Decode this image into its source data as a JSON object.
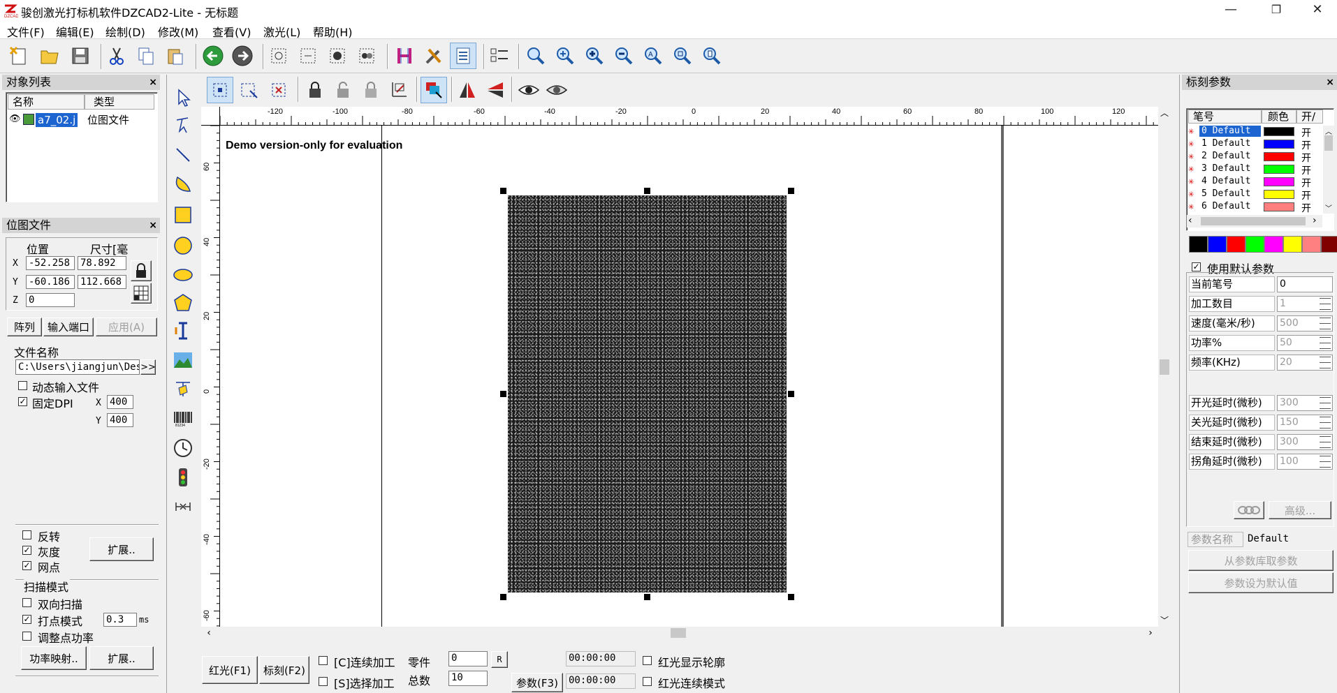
{
  "window": {
    "title": "骏创激光打标机软件DZCAD2-Lite - 无标题",
    "min_glyph": "—",
    "max_glyph": "❐",
    "close_glyph": "✕"
  },
  "menu": [
    "文件(F)",
    "编辑(E)",
    "绘制(D)",
    "修改(M)",
    "查看(V)",
    "激光(L)",
    "帮助(H)"
  ],
  "object_list": {
    "title": "对象列表",
    "columns": [
      "名称",
      "类型"
    ],
    "rows": [
      {
        "name": "a7_02.j",
        "type": "位图文件"
      }
    ]
  },
  "bitmap_panel": {
    "title": "位图文件",
    "pos_header": "位置",
    "size_header": "尺寸[毫",
    "x_label": "X",
    "y_label": "Y",
    "z_label": "Z",
    "x_pos": "-52.258",
    "x_size": "78.892",
    "y_pos": "-60.186",
    "y_size": "112.668",
    "z_pos": "0",
    "array_btn": "阵列",
    "port_btn": "输入端口",
    "apply_btn": "应用(A)",
    "file_name_label": "文件名称",
    "file_path": "C:\\Users\\jiangjun\\Des",
    "browse_btn": ">>",
    "dynamic_input": "动态输入文件",
    "fixed_dpi": "固定DPI",
    "dpi_x_label": "X",
    "dpi_x": "400",
    "dpi_y_label": "Y",
    "dpi_y": "400",
    "invert": "反转",
    "gray": "灰度",
    "dither": "网点",
    "expand_btn": "扩展..",
    "scan_mode": "扫描模式",
    "bidirectional": "双向扫描",
    "dot_mode": "打点模式",
    "dot_time": "0.3",
    "dot_unit": "ms",
    "adjust_power": "调整点功率",
    "power_map_btn": "功率映射..",
    "expand_btn2": "扩展.."
  },
  "canvas": {
    "watermark": "Demo version-only for evaluation",
    "ruler_top": [
      "-120",
      "-100",
      "-80",
      "-60",
      "-40",
      "-20",
      "0",
      "20",
      "40",
      "60",
      "80",
      "100",
      "120"
    ],
    "ruler_left": [
      "60",
      "40",
      "20",
      "0",
      "-20",
      "-40",
      "-60"
    ]
  },
  "bottom": {
    "red_btn": "红光(F1)",
    "mark_btn": "标刻(F2)",
    "continuous": "[C]连续加工",
    "select": "[S]选择加工",
    "parts_label": "零件",
    "parts_value": "0",
    "r_btn": "R",
    "total_label": "总数",
    "total_value": "10",
    "param_btn": "参数(F3)",
    "time1": "00:00:00",
    "time2": "00:00:00",
    "red_outline": "红光显示轮廓",
    "red_continuous": "红光连续模式"
  },
  "mark_params": {
    "title": "标刻参数",
    "columns": [
      "笔号",
      "颜色",
      "开/"
    ],
    "pens": [
      {
        "label": "0 Default",
        "color": "#000000",
        "on": "开"
      },
      {
        "label": "1 Default",
        "color": "#0000ff",
        "on": "开"
      },
      {
        "label": "2 Default",
        "color": "#ff0000",
        "on": "开"
      },
      {
        "label": "3 Default",
        "color": "#00ff00",
        "on": "开"
      },
      {
        "label": "4 Default",
        "color": "#ff00ff",
        "on": "开"
      },
      {
        "label": "5 Default",
        "color": "#ffff00",
        "on": "开"
      },
      {
        "label": "6 Default",
        "color": "#ff7f7f",
        "on": "开"
      }
    ],
    "palette": [
      "#000000",
      "#0000ff",
      "#ff0000",
      "#00ff00",
      "#ff00ff",
      "#ffff00",
      "#ff8080",
      "#800000"
    ],
    "use_default": "使用默认参数",
    "current_pen_label": "当前笔号",
    "current_pen": "0",
    "count_label": "加工数目",
    "count": "1",
    "speed_label": "速度(毫米/秒)",
    "speed": "500",
    "power_label": "功率%",
    "power": "50",
    "freq_label": "频率(KHz)",
    "freq": "20",
    "on_delay_label": "开光延时(微秒)",
    "on_delay": "300",
    "off_delay_label": "关光延时(微秒)",
    "off_delay": "150",
    "end_delay_label": "结束延时(微秒)",
    "end_delay": "300",
    "corner_delay_label": "拐角延时(微秒)",
    "corner_delay": "100",
    "advanced_btn": "高级...",
    "param_name_label": "参数名称",
    "param_name": "Default",
    "from_lib_btn": "从参数库取参数",
    "set_default_btn": "参数设为默认值"
  }
}
